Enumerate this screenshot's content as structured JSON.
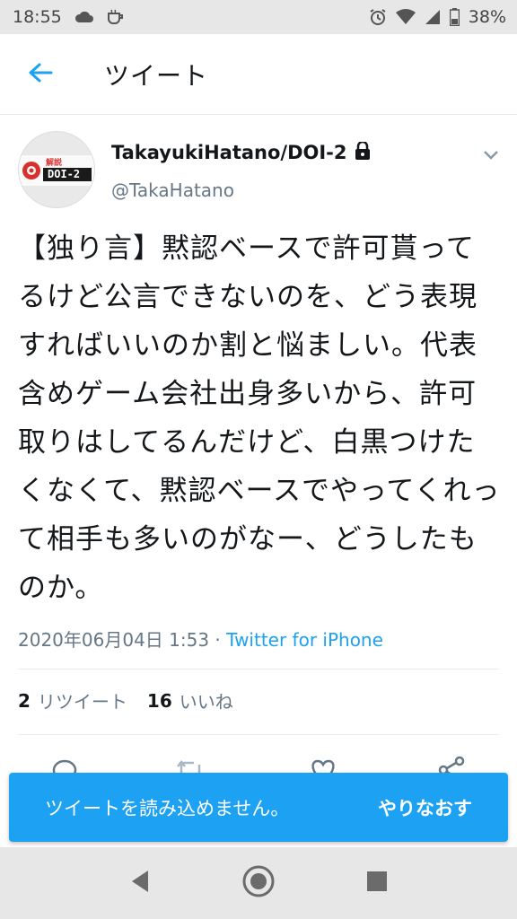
{
  "status_bar": {
    "time": "18:55",
    "battery": "38%"
  },
  "app_bar": {
    "title": "ツイート",
    "back_icon": "arrow-left-icon"
  },
  "tweet": {
    "display_name": "TakayukiHatano/DOI-2",
    "handle": "@TakaHatano",
    "locked_icon": "lock-icon",
    "avatar_logo_text": "DOI-2",
    "avatar_logo_sub": "解説",
    "text": "【独り言】黙認ベースで許可貰ってるけど公言できないのを、どう表現すればいいのか割と悩ましい。代表含めゲーム会社出身多いから、許可取りはしてるんだけど、白黒つけたくなくて、黙認ベースでやってくれって相手も多いのがなー、どうしたものか。",
    "timestamp": "2020年06月04日 1:53",
    "separator": " · ",
    "source": "Twitter for iPhone",
    "retweets_count": "2",
    "retweets_label": "リツイート",
    "likes_count": "16",
    "likes_label": "いいね"
  },
  "toast": {
    "message": "ツイートを読み込めません。",
    "action": "やりなおす"
  },
  "colors": {
    "accent": "#1da1f2",
    "text": "#14171a",
    "secondary": "#657786",
    "status_bg": "#e7e7e7"
  }
}
